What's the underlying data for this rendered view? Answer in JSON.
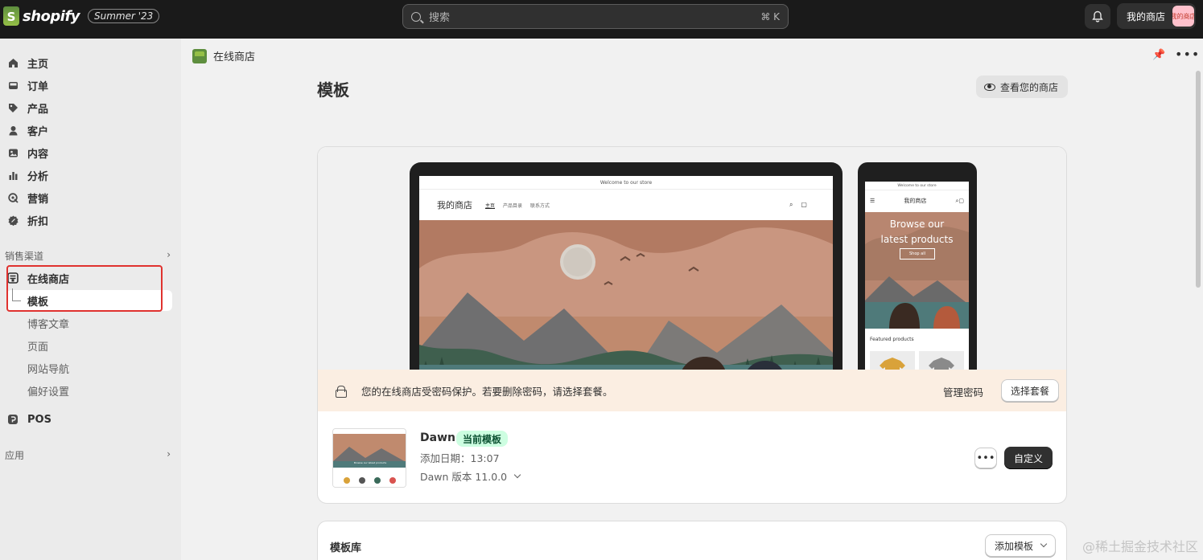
{
  "topbar": {
    "logo_letter": "S",
    "logo_text": "shopify",
    "edition": "Summer '23",
    "search_placeholder": "搜索",
    "search_shortcut": "⌘ K",
    "store_name": "我的商店",
    "avatar_text": "我的商店"
  },
  "sidebar": {
    "items": [
      {
        "label": "主页",
        "icon": "home-icon"
      },
      {
        "label": "订单",
        "icon": "inbox-icon"
      },
      {
        "label": "产品",
        "icon": "tag-icon"
      },
      {
        "label": "客户",
        "icon": "person-icon"
      },
      {
        "label": "内容",
        "icon": "image-icon"
      },
      {
        "label": "分析",
        "icon": "bar-chart-icon"
      },
      {
        "label": "营销",
        "icon": "target-icon"
      },
      {
        "label": "折扣",
        "icon": "discount-icon"
      }
    ],
    "sales_channels_label": "销售渠道",
    "online_store": "在线商店",
    "online_store_sub": [
      "模板",
      "博客文章",
      "页面",
      "网站导航",
      "偏好设置"
    ],
    "pos": "POS",
    "apps_label": "应用"
  },
  "header": {
    "breadcrumb": "在线商店",
    "title": "模板",
    "view_store": "查看您的商店"
  },
  "preview": {
    "desktop_announcement": "Welcome to our store",
    "desktop_store_name": "我的商店",
    "desktop_nav": [
      "主页",
      "产品目录",
      "联系方式"
    ],
    "mobile_announcement": "Welcome to our store",
    "mobile_store_name": "我的商店",
    "mobile_hero_line1": "Browse our",
    "mobile_hero_line2": "latest products",
    "mobile_shop_all": "Shop all",
    "mobile_featured": "Featured products"
  },
  "banner": {
    "text": "您的在线商店受密码保护。若要删除密码，请选择套餐。",
    "manage_password": "管理密码",
    "choose_plan": "选择套餐"
  },
  "theme": {
    "name": "Dawn",
    "badge": "当前模板",
    "date": "添加日期：13:07",
    "version": "Dawn 版本 11.0.0",
    "customize": "自定义",
    "more": "•••"
  },
  "library": {
    "title": "模板库",
    "add_theme": "添加模板"
  },
  "watermark": "@稀土掘金技术社区",
  "colors": {
    "topbar": "#1a1a1a",
    "accent_red_box": "#e0322f",
    "badge_bg": "#cdfee1",
    "banner_bg": "#fbeee2"
  }
}
